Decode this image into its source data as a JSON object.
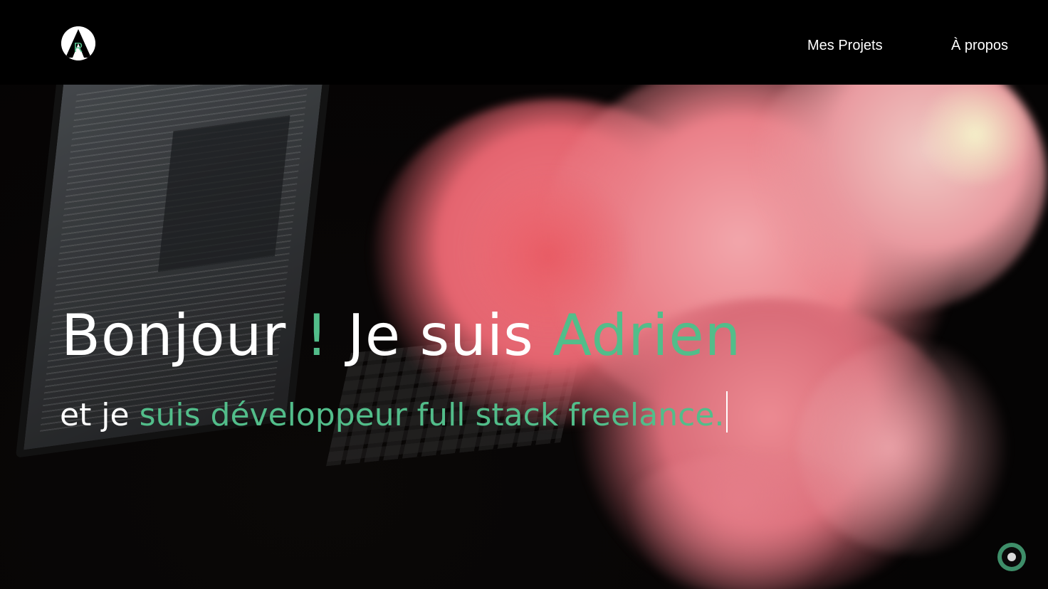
{
  "brand": {
    "logo_letter": "R",
    "logo_icon": "a-logo-icon"
  },
  "nav": {
    "projects_label": "Mes Projets",
    "about_label": "À propos"
  },
  "hero": {
    "headline": {
      "part1": "Bonjour ",
      "exclamation": "!",
      "part2": " Je suis ",
      "name": "Adrien"
    },
    "subline": {
      "prefix": "et je ",
      "role": "suis développeur full stack freelance."
    },
    "scroll_icon": "scroll-down-icon"
  },
  "colors": {
    "accent": "#52bd8a",
    "nav_background": "#000000",
    "text": "#ffffff",
    "smoke": "#e8707a"
  }
}
